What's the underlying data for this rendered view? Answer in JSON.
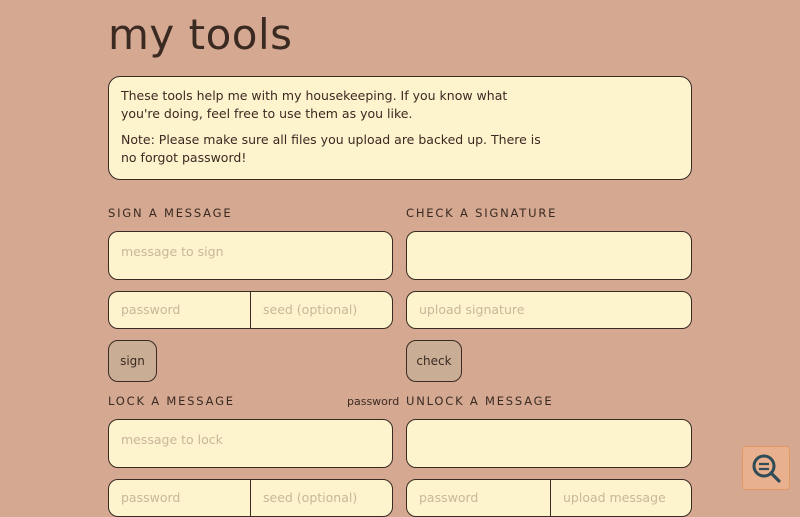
{
  "header": {
    "title": "my tools"
  },
  "intro": {
    "paragraph1": "These tools help me with my housekeeping. If you know what you're doing, feel free to use them as you like.",
    "paragraph2": "Note: Please make sure all files you upload are backed up. There is no forgot password!"
  },
  "sign": {
    "label": "SIGN A MESSAGE",
    "message_placeholder": "message to sign",
    "password_placeholder": "password",
    "seed_placeholder": "seed (optional)",
    "button": "sign"
  },
  "check": {
    "label": "CHECK A SIGNATURE",
    "message_value": "",
    "upload_placeholder": "upload signature",
    "button": "check"
  },
  "lock": {
    "label": "LOCK A MESSAGE",
    "password_link": "password",
    "message_placeholder": "message to lock",
    "password_placeholder": "password",
    "seed_placeholder": "seed (optional)"
  },
  "unlock": {
    "label": "UNLOCK A MESSAGE",
    "message_value": "",
    "password_placeholder": "password",
    "upload_placeholder": "upload message"
  },
  "icons": {
    "floating_button": "search-icon"
  },
  "colors": {
    "background": "#d4a891",
    "panel": "#fdf3cd",
    "border": "#3a2a22",
    "button": "#c9ad95",
    "accent": "#e39a62"
  }
}
